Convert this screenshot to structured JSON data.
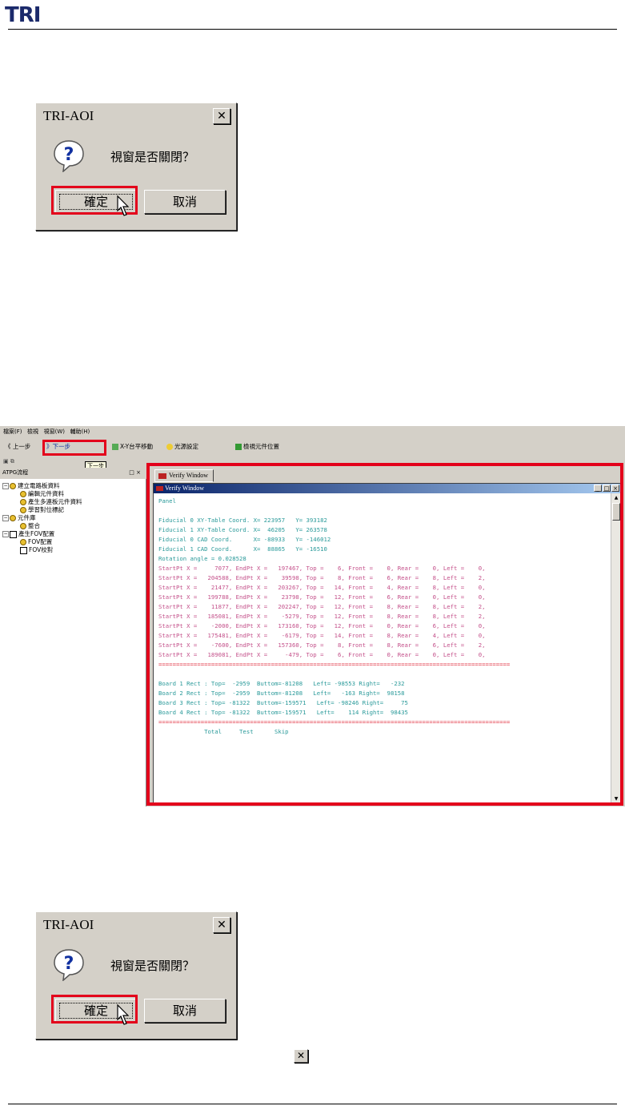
{
  "logo": "TRI",
  "dialog": {
    "title": "TRI-AOI",
    "message": "視窗是否關閉？",
    "ok_label": "確定",
    "cancel_label": "取消",
    "close_glyph": "✕"
  },
  "app": {
    "menu": [
      "檔案(F)",
      "檢視",
      "視窗(W)",
      "輔助(H)"
    ],
    "toolbar": {
      "prev": "《 上一步",
      "next": "》下一步",
      "xy_move": "X-Y台平移動",
      "light": "光源設定",
      "check_pos": "檢視元件位置"
    },
    "tooltip": "下一步",
    "panel_title": "ATPG流程",
    "panel_close": "□ ×",
    "tree": [
      "建立電路板資料",
      "編輯元件資料",
      "產生多連板元件資料",
      "學習對位標記",
      "元件庫",
      "整合",
      "產生FOV配置",
      "FOV配置",
      "FOV校對"
    ],
    "verify": {
      "tab_label": "Verify Window",
      "window_title": "Verify Window",
      "lines": [
        {
          "c": "teal",
          "t": "Panel"
        },
        {
          "c": "teal",
          "t": ""
        },
        {
          "c": "teal",
          "t": "Fiducial 0 XY-Table Coord. X= 223957   Y= 393182"
        },
        {
          "c": "teal",
          "t": "Fiducial 1 XY-Table Coord. X=  46205   Y= 263578"
        },
        {
          "c": "teal",
          "t": "Fiducial 0 CAD Coord.      X= -88933   Y= -146012"
        },
        {
          "c": "teal",
          "t": "Fiducial 1 CAD Coord.      X=  88865   Y= -16510"
        },
        {
          "c": "teal",
          "t": "Rotation angle = 0.028528"
        },
        {
          "c": "pink",
          "t": "StartPt X =     7077, EndPt X =   197467, Top =    6, Front =    0, Rear =    0, Left =    0,"
        },
        {
          "c": "pink",
          "t": "StartPt X =   204588, EndPt X =    39598, Top =    8, Front =    6, Rear =    8, Left =    2,"
        },
        {
          "c": "pink",
          "t": "StartPt X =    21477, EndPt X =   203267, Top =   14, Front =    4, Rear =    8, Left =    0,"
        },
        {
          "c": "pink",
          "t": "StartPt X =   199788, EndPt X =    23798, Top =   12, Front =    6, Rear =    0, Left =    0,"
        },
        {
          "c": "pink",
          "t": "StartPt X =    11877, EndPt X =   202247, Top =   12, Front =    8, Rear =    8, Left =    2,"
        },
        {
          "c": "pink",
          "t": "StartPt X =   185081, EndPt X =    -5279, Top =   12, Front =    8, Rear =    8, Left =    2,"
        },
        {
          "c": "pink",
          "t": "StartPt X =    -2000, EndPt X =   173160, Top =   12, Front =    0, Rear =    6, Left =    0,"
        },
        {
          "c": "pink",
          "t": "StartPt X =   175481, EndPt X =    -6179, Top =   14, Front =    8, Rear =    4, Left =    0,"
        },
        {
          "c": "pink",
          "t": "StartPt X =    -7600, EndPt X =   157360, Top =    8, Front =    8, Rear =    6, Left =    2,"
        },
        {
          "c": "pink",
          "t": "StartPt X =   189081, EndPt X =     -479, Top =    6, Front =    0, Rear =    0, Left =    0,"
        },
        {
          "c": "dash",
          "t": "===================================================================================================="
        },
        {
          "c": "teal",
          "t": ""
        },
        {
          "c": "teal",
          "t": "Board 1 Rect : Top=  -2959  Buttom=-81208   Left= -98553 Right=   -232"
        },
        {
          "c": "teal",
          "t": "Board 2 Rect : Top=  -2959  Buttom=-81208   Left=   -163 Right=  98158"
        },
        {
          "c": "teal",
          "t": "Board 3 Rect : Top= -81322  Buttom=-159571   Left= -98246 Right=     75"
        },
        {
          "c": "teal",
          "t": "Board 4 Rect : Top= -81322  Buttom=-159571   Left=    114 Right=  98435"
        },
        {
          "c": "dash",
          "t": "===================================================================================================="
        },
        {
          "c": "teal",
          "t": "             Total     Test      Skip"
        }
      ]
    }
  },
  "bottom_close_glyph": "✕",
  "colors": {
    "highlight": "#e3001b",
    "logo": "#1b2a6b",
    "teal": "#2a9a9a",
    "pink": "#c4508a"
  }
}
